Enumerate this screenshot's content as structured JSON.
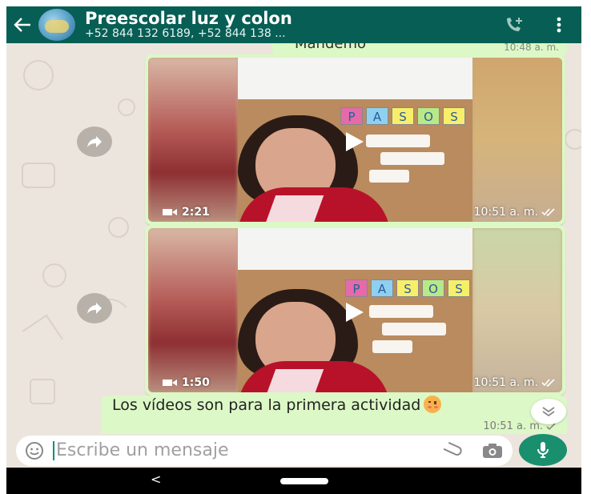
{
  "header": {
    "title": "Preescolar luz y colon",
    "subtitle": "+52 844 132 6189, +52 844 138 ...",
    "bg_color": "#075e54",
    "back_icon": "arrow-left-icon",
    "call_icon": "add-call-icon",
    "menu_icon": "more-vert-icon"
  },
  "messages": {
    "prev_fragment": "Mandemo",
    "prev_time": "10:48 a. m.",
    "video1": {
      "duration": "2:21",
      "time": "10:51 a. m."
    },
    "video2": {
      "duration": "1:50",
      "time": "10:51 a. m."
    },
    "video_board_letters": [
      "P",
      "A",
      "S",
      "O",
      "S"
    ],
    "text": "Los vídeos son para la primera actividad",
    "text_time": "10:51 a. m.",
    "bubble_color": "#dcf8c6"
  },
  "composer": {
    "placeholder": "Escribe un mensaje",
    "mic_color": "#1a8f6e"
  },
  "navbar": {
    "back_glyph": "<"
  }
}
